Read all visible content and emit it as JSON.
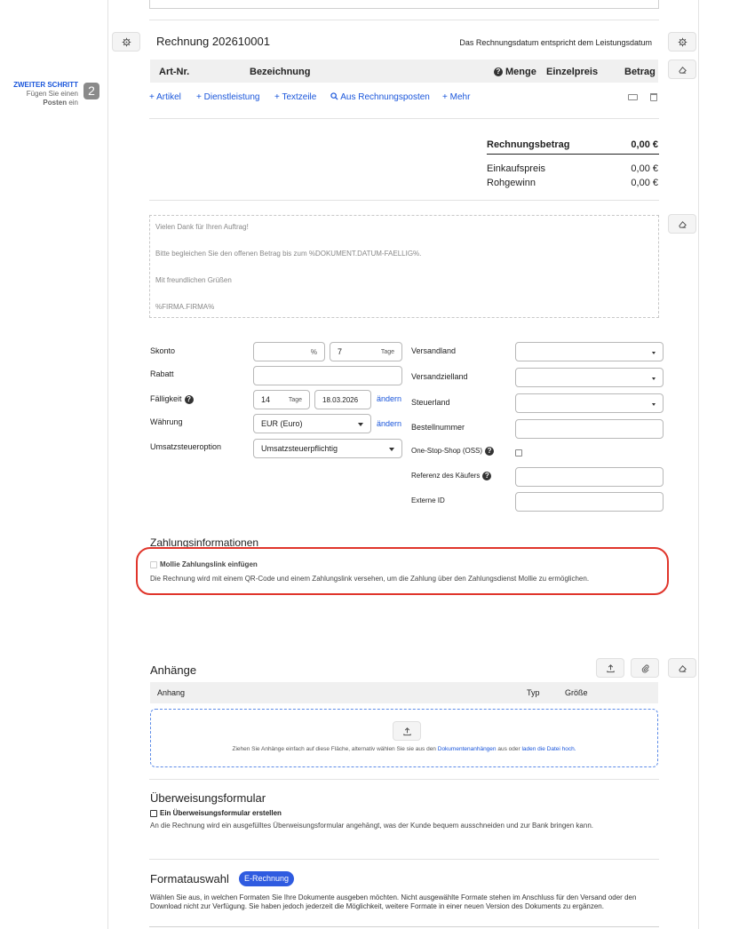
{
  "sidebar": {
    "step_title": "ZWEITER SCHRITT",
    "step_line1": "Fügen Sie einen",
    "step_bold": "Posten",
    "step_rest": "ein",
    "step_number": "2"
  },
  "invoice": {
    "title": "Rechnung 202610001",
    "date_note": "Das Rechnungsdatum entspricht dem Leistungsdatum"
  },
  "items_table": {
    "col_artnr": "Art-Nr.",
    "col_desc": "Bezeichnung",
    "col_qty": "Menge",
    "col_price": "Einzelpreis",
    "col_amount": "Betrag"
  },
  "add_links": [
    "Artikel",
    "Dienstleistung",
    "Textzeile",
    "Aus Rechnungsposten",
    "Mehr"
  ],
  "totals": {
    "total_label": "Rechnungsbetrag",
    "total_value": "0,00 €",
    "purchase_label": "Einkaufspreis",
    "purchase_value": "0,00 €",
    "profit_label": "Rohgewinn",
    "profit_value": "0,00 €"
  },
  "footer_text": [
    "Vielen Dank für Ihren Auftrag!",
    "Bitte begleichen Sie den offenen Betrag bis zum %DOKUMENT.DATUM-FAELLIG%.",
    "Mit freundlichen Grüßen",
    "%FIRMA.FIRMA%"
  ],
  "form": {
    "skonto_label": "Skonto",
    "skonto_pct_unit": "%",
    "skonto_days_value": "7",
    "skonto_days_unit": "Tage",
    "rabatt_label": "Rabatt",
    "faelligkeit_label": "Fälligkeit",
    "faelligkeit_days": "14",
    "faelligkeit_unit": "Tage",
    "faelligkeit_date": "18.03.2026",
    "change_link": "ändern",
    "waehrung_label": "Währung",
    "waehrung_value": "EUR (Euro)",
    "waehrung_change": "ändern",
    "ust_label": "Umsatzsteueroption",
    "ust_value": "Umsatzsteuerpflichtig",
    "versandland_label": "Versandland",
    "versandzielland_label": "Versandzielland",
    "steuerland_label": "Steuerland",
    "bestellnummer_label": "Bestellnummer",
    "oss_label": "One-Stop-Shop (OSS)",
    "referenz_label": "Referenz des Käufers",
    "externe_id_label": "Externe ID"
  },
  "payment": {
    "heading": "Zahlungsinformationen",
    "mollie_label": "Mollie Zahlungslink einfügen",
    "mollie_desc": "Die Rechnung wird mit einem QR-Code und einem Zahlungslink versehen, um die Zahlung über den Zahlungsdienst Mollie zu ermöglichen.",
    "highlight_color": "#e0352b"
  },
  "attachments": {
    "heading": "Anhänge",
    "col_anhang": "Anhang",
    "col_typ": "Typ",
    "col_groesse": "Größe",
    "drop_text_1": "Ziehen Sie Anhänge einfach auf diese Fläche, alternativ wählen Sie sie aus den",
    "drop_link_1": "Dokumentenanhängen",
    "drop_text_2": "aus oder",
    "drop_link_2": "laden die Datei hoch."
  },
  "transfer": {
    "heading": "Überweisungsformular",
    "checkbox_label": "Ein Überweisungsformular erstellen",
    "desc": "An die Rechnung wird ein ausgefülltes Überweisungsformular angehängt, was der Kunde bequem ausschneiden und zur Bank bringen kann."
  },
  "format": {
    "heading": "Formatauswahl",
    "badge": "E-Rechnung",
    "badge_color": "#2f5be0",
    "desc": "Wählen Sie aus, in welchen Formaten Sie Ihre Dokumente ausgeben möchten. Nicht ausgewählte Formate stehen im Anschluss für den Versand oder den Download nicht zur Verfügung. Sie haben jedoch jederzeit die Möglichkeit, weitere Formate in einer neuen Version des Dokuments zu ergänzen."
  }
}
